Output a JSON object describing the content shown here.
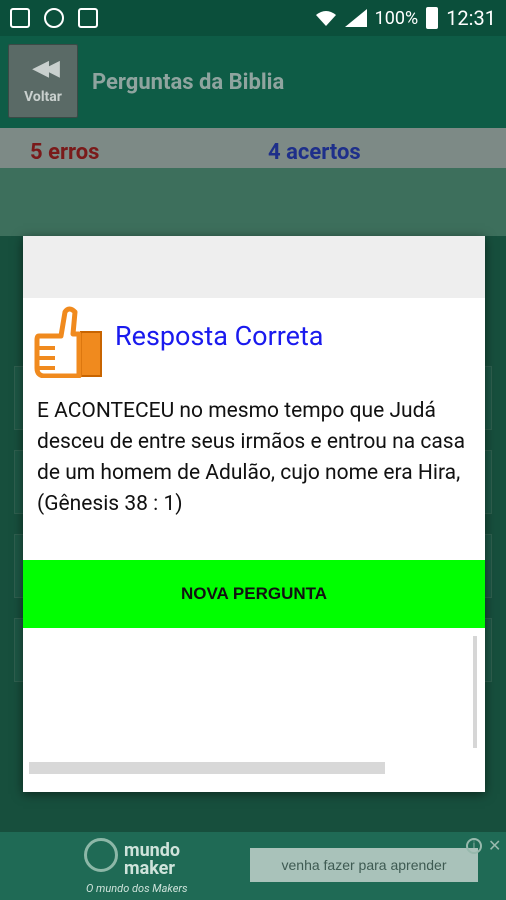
{
  "status_bar": {
    "battery": "100%",
    "time": "12:31"
  },
  "header": {
    "back_label": "Voltar",
    "title": "Perguntas da Biblia"
  },
  "score": {
    "errors": "5 erros",
    "hits": "4 acertos"
  },
  "dialog": {
    "title": "Resposta Correta",
    "message": "E ACONTECEU no mesmo tempo que Judá desceu de entre seus irmãos e entrou na casa de um homem de Adulão, cujo nome era Hira, (Gênesis 38 : 1)",
    "button_label": "NOVA PERGUNTA",
    "icon": "thumbs-up-icon",
    "accent": "#00ff00",
    "title_color": "#1a1aee"
  },
  "ad": {
    "brand": "mundo maker",
    "tagline": "O mundo dos Makers",
    "cta": "venha fazer para aprender"
  }
}
